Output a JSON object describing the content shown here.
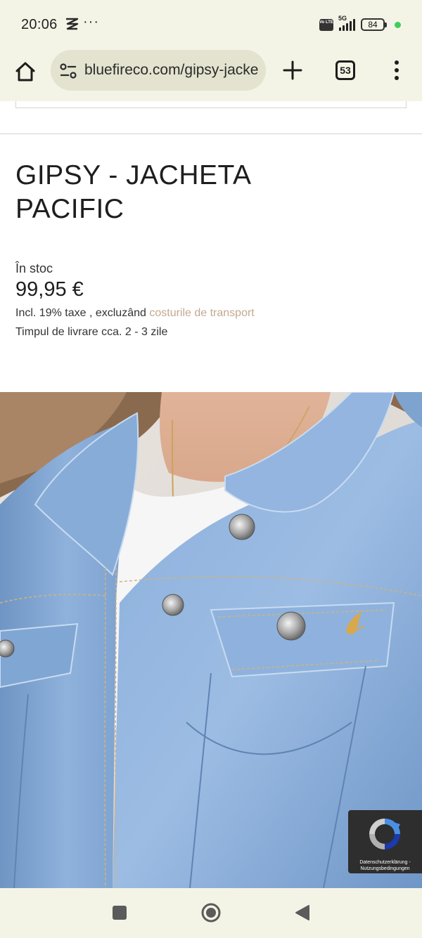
{
  "status_bar": {
    "time": "20:06",
    "dots": "···",
    "network": "5G",
    "volte": "Vo LTE",
    "battery": "84"
  },
  "browser": {
    "url": "bluefireco.com/gipsy-jacke",
    "tab_count": "53"
  },
  "product": {
    "title": "GIPSY - JACHETA PACIFIC",
    "stock": "În stoc",
    "price": "99,95 €",
    "tax_text": "Incl. 19% taxe , excluzând",
    "shipping_link": "costurile de transport",
    "delivery": "Timpul de livrare cca. 2 - 3 zile"
  },
  "recaptcha": {
    "privacy": "Datenschutzerklärung",
    "separator": " - ",
    "terms": "Nutzungsbedingungen"
  },
  "colors": {
    "browser_chrome": "#f4f4e6",
    "url_pill": "#e3e3cf",
    "link": "#c4a990",
    "denim": "#7ea3cf",
    "recaptcha_bg": "#2e2e2e"
  },
  "icons": {
    "home": "home-icon",
    "site_settings": "tune-icon",
    "new_tab": "plus-icon",
    "tabs": "tab-switcher-icon",
    "menu": "more-vert-icon",
    "nav_recents": "square-icon",
    "nav_home": "circle-icon",
    "nav_back": "triangle-back-icon"
  }
}
